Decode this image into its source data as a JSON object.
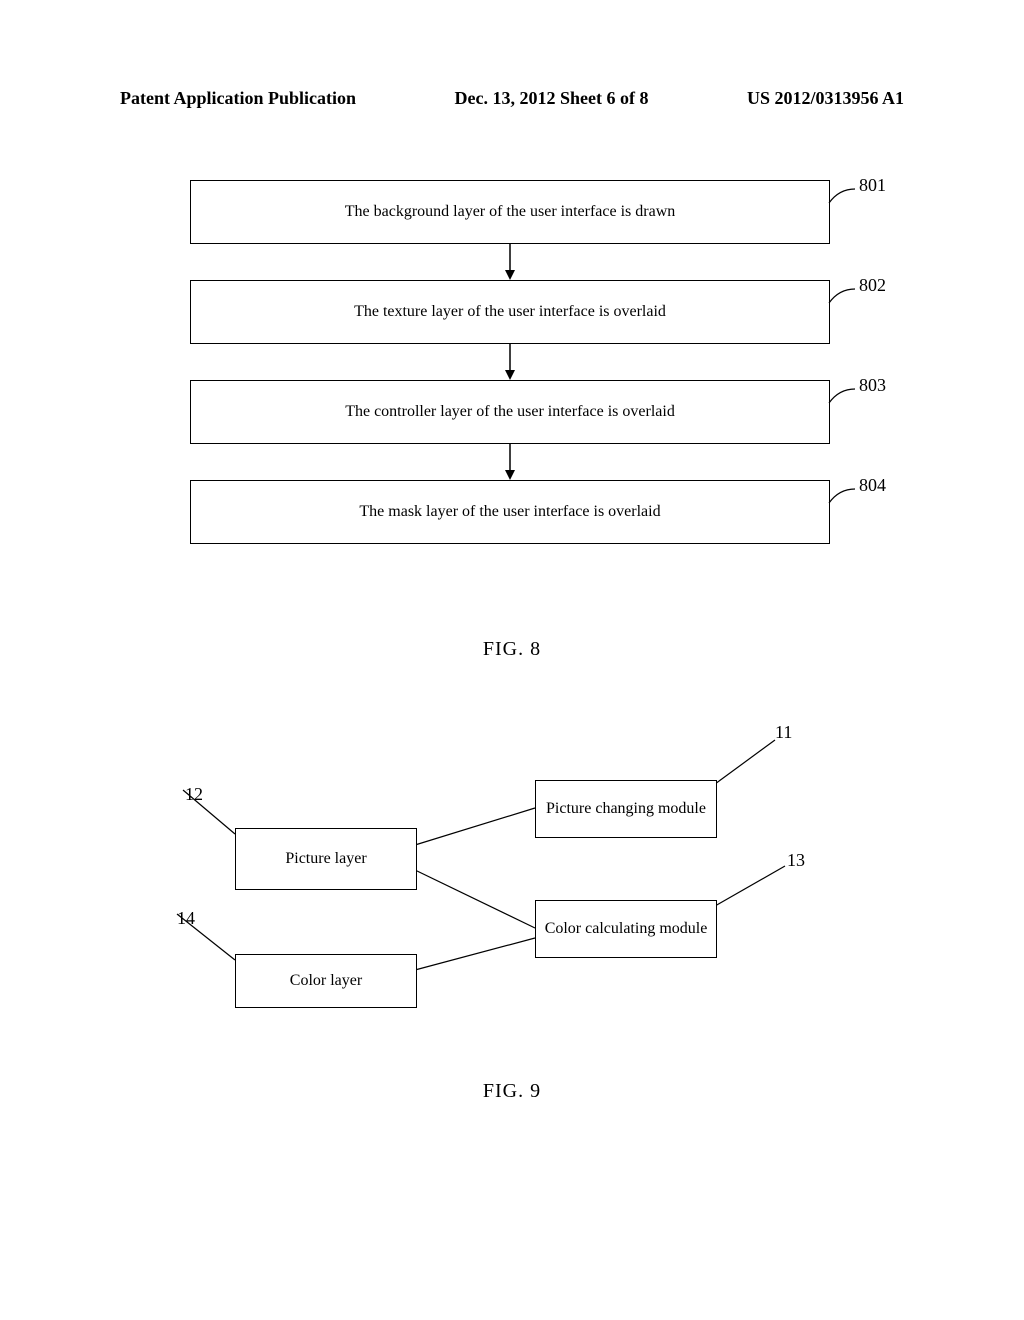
{
  "header": {
    "left": "Patent Application Publication",
    "center": "Dec. 13, 2012  Sheet 6 of 8",
    "right": "US 2012/0313956 A1"
  },
  "fig8": {
    "boxes": [
      {
        "text": "The background layer of the user interface is drawn",
        "label": "801"
      },
      {
        "text": "The texture layer of the user interface is overlaid",
        "label": "802"
      },
      {
        "text": "The controller layer of the user interface is overlaid",
        "label": "803"
      },
      {
        "text": "The mask layer of the user interface is overlaid",
        "label": "804"
      }
    ],
    "caption": "FIG. 8"
  },
  "fig9": {
    "picture_layer": "Picture layer",
    "color_layer": "Color layer",
    "picture_changing": "Picture changing module",
    "color_calc": "Color calculating module",
    "labels": {
      "l11": "11",
      "l12": "12",
      "l13": "13",
      "l14": "14"
    },
    "caption": "FIG. 9"
  }
}
